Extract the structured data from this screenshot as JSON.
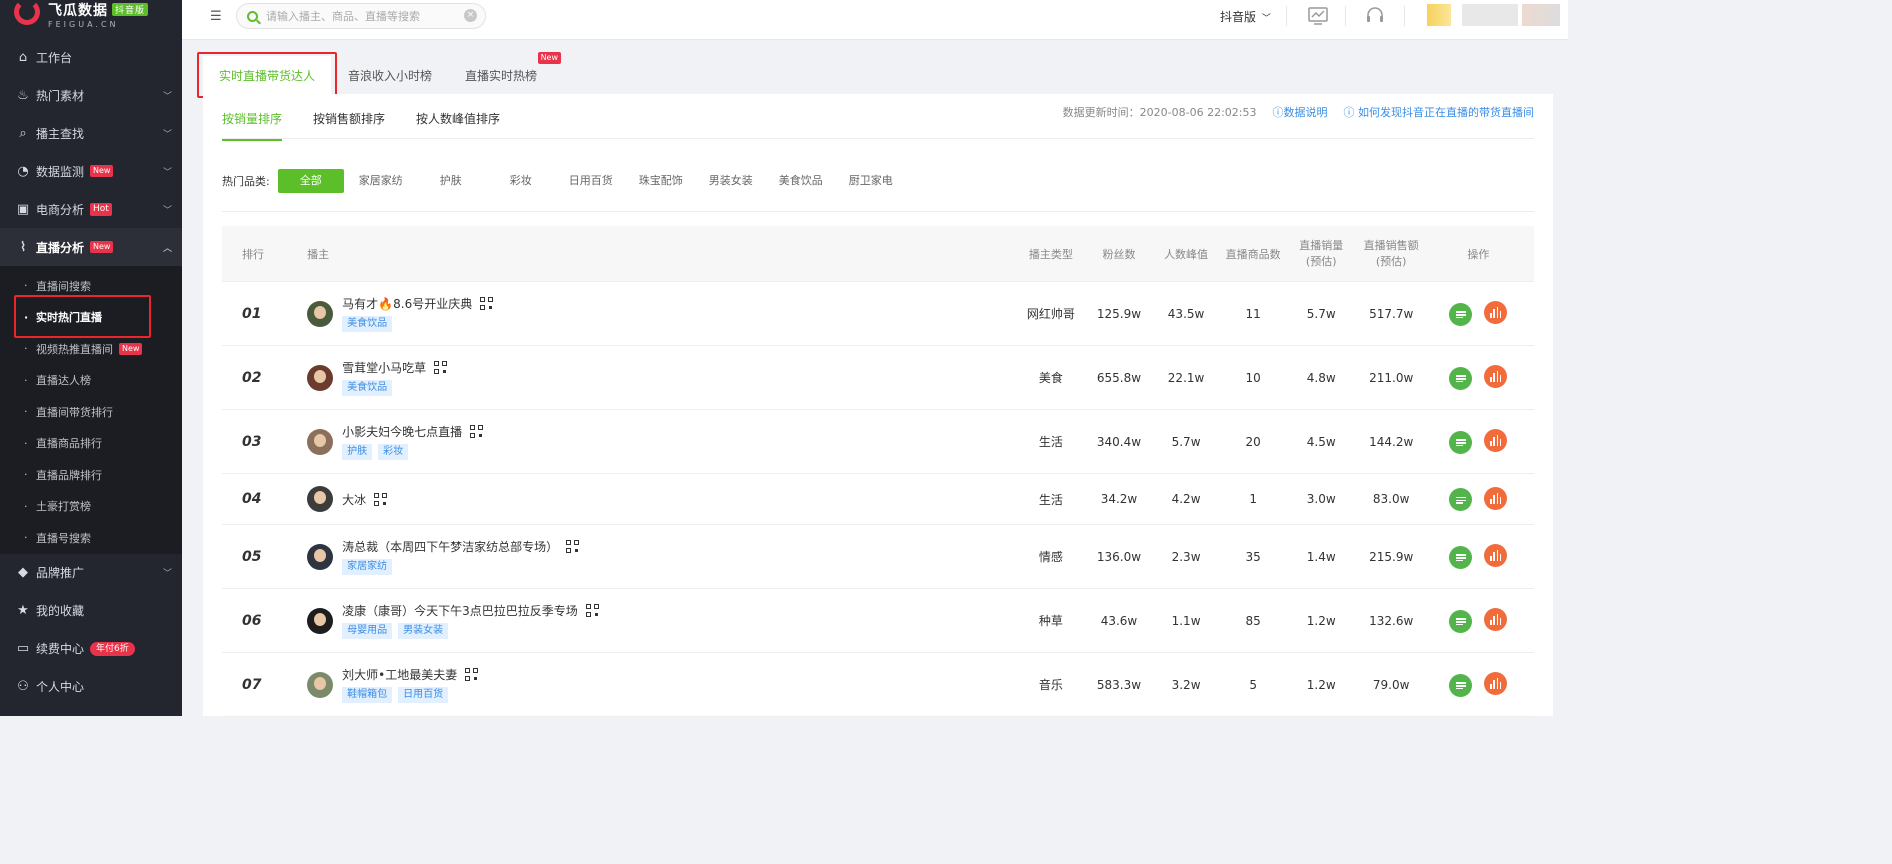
{
  "brand": {
    "name": "飞瓜数据",
    "edition": "抖音版",
    "domain": "FEIGUA.CN"
  },
  "sidebar": {
    "items": [
      {
        "label": "工作台",
        "icon": "home-icon"
      },
      {
        "label": "热门素材",
        "icon": "fire-icon"
      },
      {
        "label": "播主查找",
        "icon": "search-icon"
      },
      {
        "label": "数据监测",
        "icon": "monitor-icon",
        "badge": "New"
      },
      {
        "label": "电商分析",
        "icon": "shop-bag-icon",
        "badge": "Hot"
      },
      {
        "label": "直播分析",
        "icon": "trend-icon",
        "badge": "New"
      },
      {
        "label": "品牌推广",
        "icon": "diamond-icon"
      },
      {
        "label": "我的收藏",
        "icon": "star-icon"
      },
      {
        "label": "续费中心",
        "icon": "card-icon",
        "badge": "年付6折"
      },
      {
        "label": "个人中心",
        "icon": "user-icon"
      }
    ],
    "live_sub": [
      {
        "label": "直播间搜索"
      },
      {
        "label": "实时热门直播"
      },
      {
        "label": "视频热推直播间",
        "badge": "New"
      },
      {
        "label": "直播达人榜"
      },
      {
        "label": "直播间带货排行"
      },
      {
        "label": "直播商品排行"
      },
      {
        "label": "直播品牌排行"
      },
      {
        "label": "土豪打赏榜"
      },
      {
        "label": "直播号搜索"
      }
    ]
  },
  "topbar": {
    "search_placeholder": "请输入播主、商品、直播等搜索",
    "platform": "抖音版"
  },
  "tabs": [
    {
      "label": "实时直播带货达人"
    },
    {
      "label": "音浪收入小时榜"
    },
    {
      "label": "直播实时热榜",
      "badge": "New"
    }
  ],
  "subtabs": [
    {
      "label": "按销量排序"
    },
    {
      "label": "按销售额排序"
    },
    {
      "label": "按人数峰值排序"
    }
  ],
  "update": {
    "time_label": "数据更新时间：2020-08-06 22:02:53",
    "data_note": "数据说明",
    "how_to": "如何发现抖音正在直播的带货直播间"
  },
  "filters": {
    "label": "热门品类:",
    "options": [
      "全部",
      "家居家纺",
      "护肤",
      "彩妆",
      "日用百货",
      "珠宝配饰",
      "男装女装",
      "美食饮品",
      "厨卫家电"
    ]
  },
  "table": {
    "headers": {
      "rank": "排行",
      "host": "播主",
      "type": "播主类型",
      "fans": "粉丝数",
      "peak": "人数峰值",
      "goods": "直播商品数",
      "sales_1": "直播销量",
      "sales_2": "(预估)",
      "amount_1": "直播销售额",
      "amount_2": "(预估)",
      "ops": "操作"
    },
    "rows": [
      {
        "rank": "01",
        "name": "马有才🔥8.6号开业庆典",
        "tags": [
          "美食饮品"
        ],
        "type": "网红帅哥",
        "fans": "125.9w",
        "peak": "43.5w",
        "goods": "11",
        "sales": "5.7w",
        "amount": "517.7w"
      },
      {
        "rank": "02",
        "name": "雪茸堂小马吃草",
        "tags": [
          "美食饮品"
        ],
        "type": "美食",
        "fans": "655.8w",
        "peak": "22.1w",
        "goods": "10",
        "sales": "4.8w",
        "amount": "211.0w"
      },
      {
        "rank": "03",
        "name": "小影夫妇今晚七点直播",
        "tags": [
          "护肤",
          "彩妆"
        ],
        "type": "生活",
        "fans": "340.4w",
        "peak": "5.7w",
        "goods": "20",
        "sales": "4.5w",
        "amount": "144.2w"
      },
      {
        "rank": "04",
        "name": "大冰",
        "tags": [],
        "type": "生活",
        "fans": "34.2w",
        "peak": "4.2w",
        "goods": "1",
        "sales": "3.0w",
        "amount": "83.0w"
      },
      {
        "rank": "05",
        "name": "涛总裁（本周四下午梦洁家纺总部专场）",
        "tags": [
          "家居家纺"
        ],
        "type": "情感",
        "fans": "136.0w",
        "peak": "2.3w",
        "goods": "35",
        "sales": "1.4w",
        "amount": "215.9w"
      },
      {
        "rank": "06",
        "name": "凌康（康哥）今天下午3点巴拉巴拉反季专场",
        "tags": [
          "母婴用品",
          "男装女装"
        ],
        "type": "种草",
        "fans": "43.6w",
        "peak": "1.1w",
        "goods": "85",
        "sales": "1.2w",
        "amount": "132.6w"
      },
      {
        "rank": "07",
        "name": "刘大师•工地最美夫妻",
        "tags": [
          "鞋帽箱包",
          "日用百货"
        ],
        "type": "音乐",
        "fans": "583.3w",
        "peak": "3.2w",
        "goods": "5",
        "sales": "1.2w",
        "amount": "79.0w"
      }
    ]
  },
  "colors": {
    "accent": "#5cbf2a",
    "highlight": "#e8262c",
    "sidebar": "#23262e",
    "link": "#3a8ee6"
  }
}
